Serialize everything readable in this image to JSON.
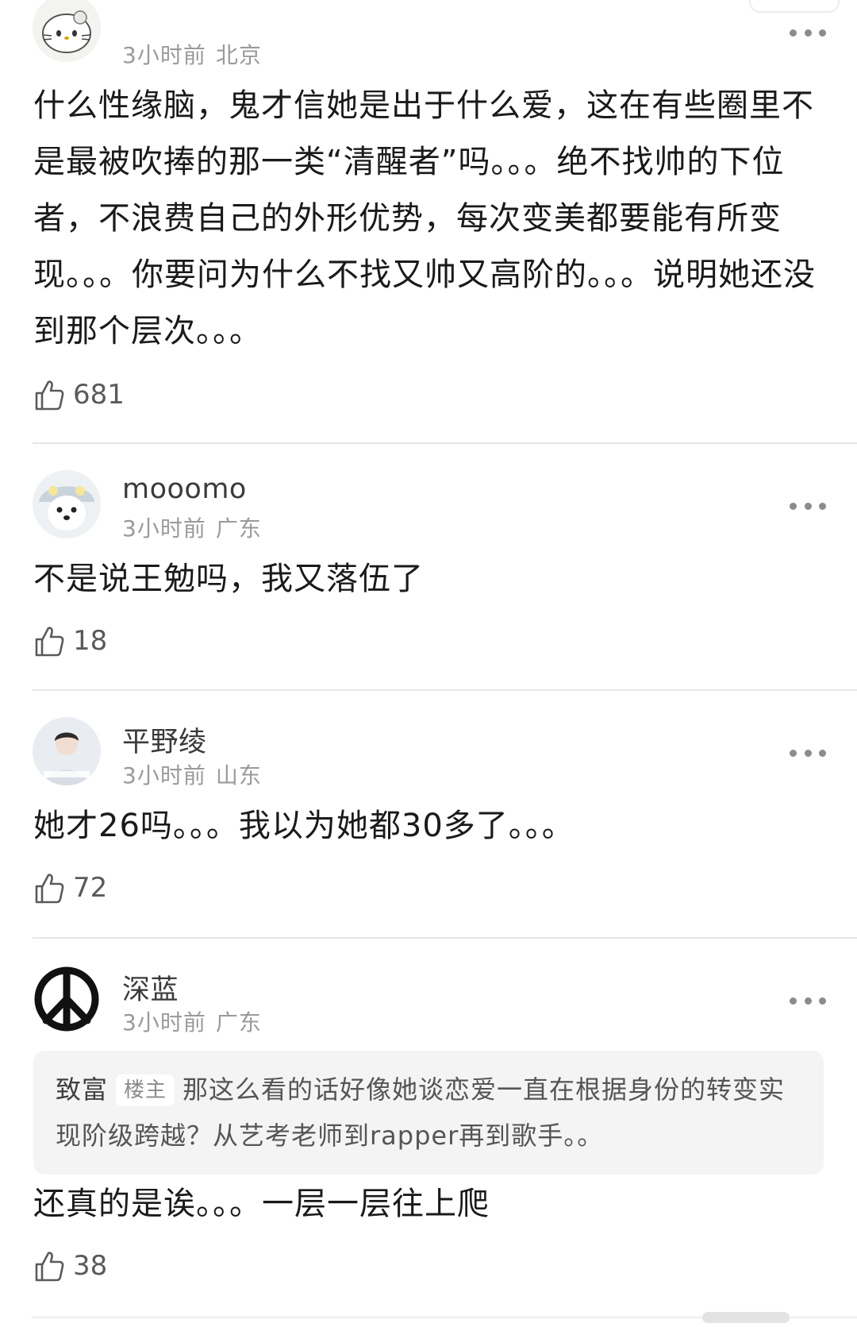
{
  "comments": [
    {
      "username": "",
      "time": "3小时前",
      "location": "北京",
      "text": "什么性缘脑，鬼才信她是出于什么爱，这在有些圈里不是最被吹捧的那一类“清醒者”吗。。。绝不找帅的下位者，不浪费自己的外形优势，每次变美都要能有所变现。。。你要问为什么不找又帅又高阶的。。。说明她还没到那个层次。。。",
      "likes": "681"
    },
    {
      "username": "mooomo",
      "time": "3小时前",
      "location": "广东",
      "text": "不是说王勉吗，我又落伍了",
      "likes": "18"
    },
    {
      "username": "平野绫",
      "time": "3小时前",
      "location": "山东",
      "text": "她才26吗。。。我以为她都30多了。。。",
      "likes": "72"
    },
    {
      "username": "深蓝",
      "time": "3小时前",
      "location": "广东",
      "quote": {
        "author": "致富",
        "badge": "楼主",
        "text": "那这么看的话好像她谈恋爱一直在根据身份的转变实现阶级跨越？从艺考老师到rapper再到歌手。。"
      },
      "text": "还真的是诶。。。一层一层往上爬",
      "likes": "38"
    }
  ]
}
